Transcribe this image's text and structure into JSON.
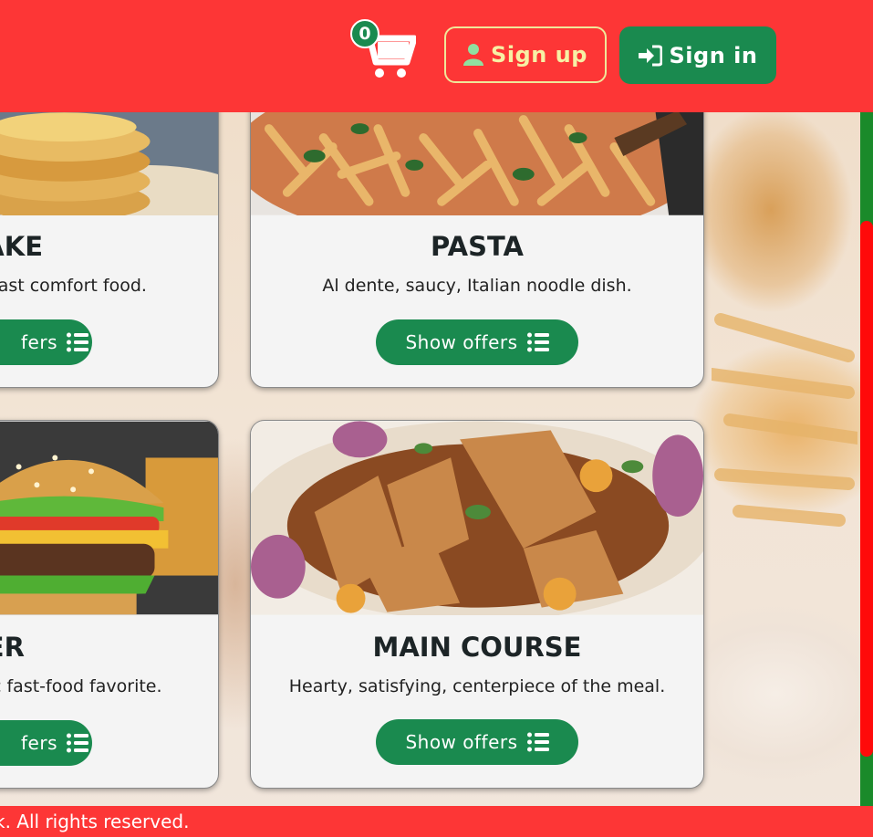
{
  "header": {
    "cart_count": "0",
    "signup_label": "Sign up",
    "signin_label": "Sign in"
  },
  "cards": [
    {
      "title": "CAKE",
      "description": "fast comfort food.",
      "offers_label": "fers"
    },
    {
      "title": "PASTA",
      "description": "Al dente, saucy, Italian noodle dish.",
      "offers_label": "Show offers"
    },
    {
      "title": "GER",
      "description": "c fast-food favorite.",
      "offers_label": "fers"
    },
    {
      "title": "MAIN COURSE",
      "description": "Hearty, satisfying, centerpiece of the meal.",
      "offers_label": "Show offers"
    }
  ],
  "footer": {
    "text": "k. All rights reserved."
  },
  "colors": {
    "brand_red": "#fd3636",
    "brand_green": "#1a8a4f",
    "signup_yellow": "#f0e79a"
  },
  "icons": {
    "cart": "cart-icon",
    "user": "user-icon",
    "signin": "sign-in-icon",
    "list": "list-icon"
  }
}
